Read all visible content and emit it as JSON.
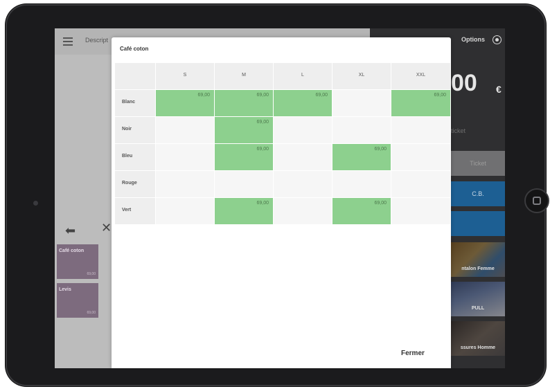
{
  "background": {
    "header_label": "Descript",
    "options_label": "Options",
    "total_amount": "00",
    "currency": "€",
    "ticket_text": "ticket",
    "ticket_button": "Ticket",
    "cb_button": "C.B.",
    "tiles": [
      {
        "label": "ntalon Femme"
      },
      {
        "label": "PULL"
      },
      {
        "label": "ssures Homme"
      }
    ],
    "products": [
      {
        "name": "Café coton",
        "price": "69,00"
      },
      {
        "name": "Levis",
        "price": "69,00"
      }
    ]
  },
  "modal": {
    "title": "Café coton",
    "columns": [
      "S",
      "M",
      "L",
      "XL",
      "XXL"
    ],
    "rows": [
      {
        "label": "Blanc",
        "cells": [
          "69,00",
          "69,00",
          "69,00",
          "",
          "69,00"
        ]
      },
      {
        "label": "Noir",
        "cells": [
          "",
          "69,00",
          "",
          "",
          ""
        ]
      },
      {
        "label": "Bleu",
        "cells": [
          "",
          "69,00",
          "",
          "69,00",
          ""
        ]
      },
      {
        "label": "Rouge",
        "cells": [
          "",
          "",
          "",
          "",
          ""
        ]
      },
      {
        "label": "Vert",
        "cells": [
          "",
          "69,00",
          "",
          "69,00",
          ""
        ]
      }
    ],
    "close_label": "Fermer"
  },
  "colors": {
    "available_cell": "#8dd08e",
    "accent_blue": "#1d5f93",
    "product_tile": "#7d6b7e"
  }
}
